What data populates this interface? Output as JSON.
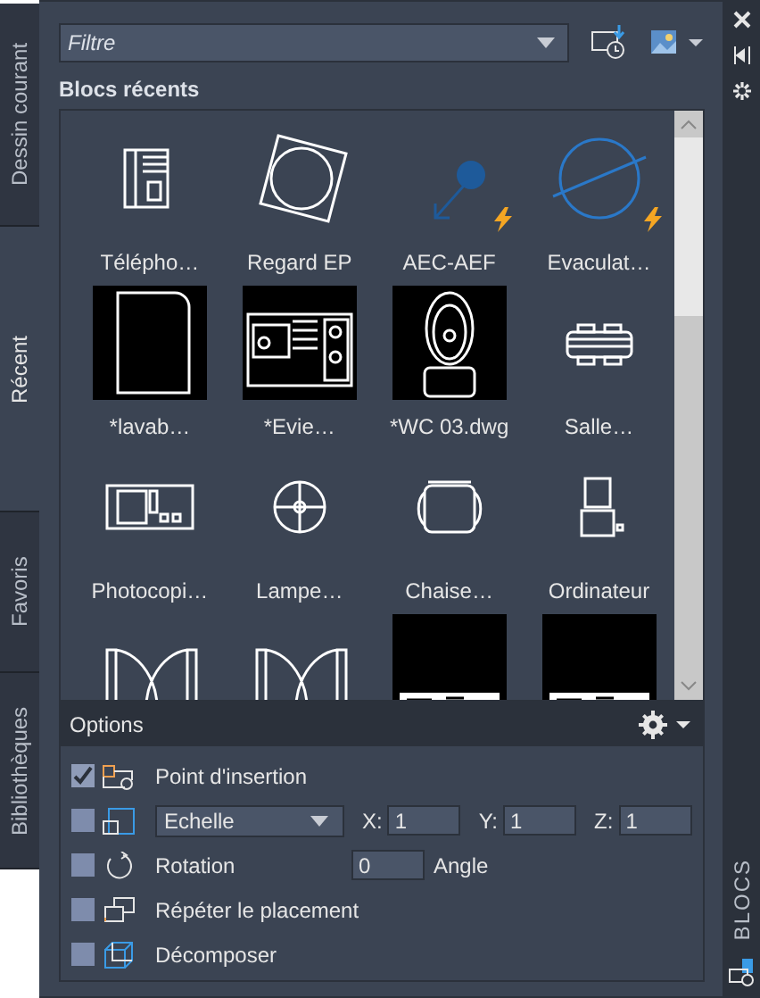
{
  "side_tabs": [
    {
      "label": "Dessin courant",
      "selected": false
    },
    {
      "label": "Récent",
      "selected": true
    },
    {
      "label": "Favoris",
      "selected": false
    },
    {
      "label": "Bibliothèques",
      "selected": false
    }
  ],
  "filter": {
    "placeholder": "Filtre"
  },
  "section_title": "Blocs récents",
  "blocks": [
    {
      "label": "Télépho…",
      "dynamic": false
    },
    {
      "label": "Regard EP",
      "dynamic": false
    },
    {
      "label": "AEC-AEF",
      "dynamic": true
    },
    {
      "label": "Evaculat…",
      "dynamic": true
    },
    {
      "label": "*lavab…",
      "dynamic": false
    },
    {
      "label": "*Evie…",
      "dynamic": false
    },
    {
      "label": "*WC 03.dwg",
      "dynamic": false
    },
    {
      "label": "Salle…",
      "dynamic": false
    },
    {
      "label": "Photocopi…",
      "dynamic": false
    },
    {
      "label": "Lampe…",
      "dynamic": false
    },
    {
      "label": "Chaise…",
      "dynamic": false
    },
    {
      "label": "Ordinateur",
      "dynamic": false
    },
    {
      "kind": "door"
    },
    {
      "kind": "door"
    },
    {
      "kind": "strip"
    },
    {
      "kind": "strip"
    }
  ],
  "options": {
    "title": "Options",
    "rows": [
      {
        "kind": "plain",
        "checked": true,
        "label": "Point d'insertion"
      },
      {
        "kind": "scale",
        "checked": false,
        "dropdown": "Echelle",
        "fields": [
          {
            "label": "X:",
            "value": "1"
          },
          {
            "label": "Y:",
            "value": "1"
          },
          {
            "label": "Z:",
            "value": "1"
          }
        ]
      },
      {
        "kind": "angle",
        "checked": false,
        "label": "Rotation",
        "value": "0",
        "unit": "Angle"
      },
      {
        "kind": "plain",
        "checked": false,
        "label": "Répéter le placement"
      },
      {
        "kind": "plain",
        "checked": false,
        "label": "Décomposer"
      }
    ]
  },
  "palette_title": "BLOCS"
}
